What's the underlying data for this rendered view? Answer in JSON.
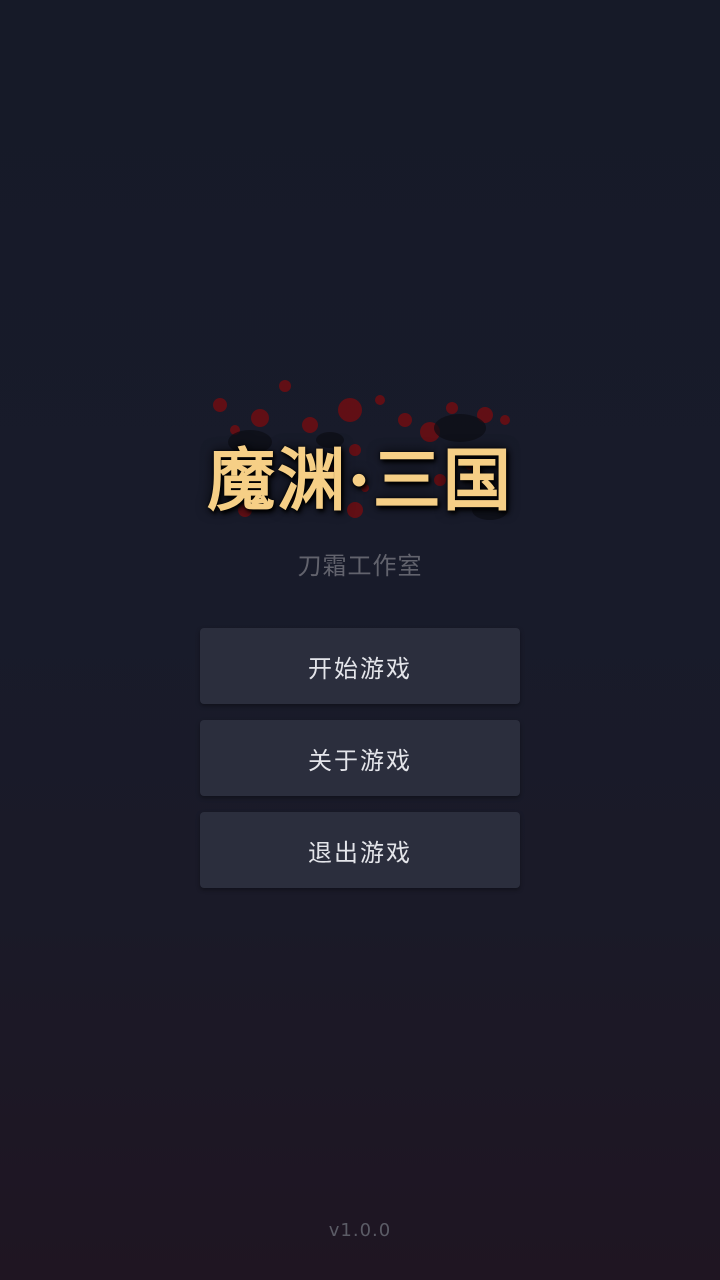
{
  "game": {
    "title": "魔渊·三国",
    "studio": "刀霜工作室",
    "version": "v1.0.0"
  },
  "menu": {
    "start_label": "开始游戏",
    "about_label": "关于游戏",
    "exit_label": "退出游戏"
  },
  "colors": {
    "title": "#f6cf86",
    "button_bg": "#2b2e3d",
    "button_text": "#e4e5ea",
    "background_top": "#161a28",
    "background_bottom": "#1f1522",
    "blood_splatter": "#7a0f14"
  }
}
